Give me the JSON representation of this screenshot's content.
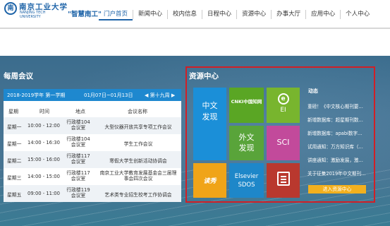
{
  "header": {
    "logo_mark": "南",
    "logo_cn": "南京工业大学",
    "logo_en": "NANJING TECH UNIVERSITY",
    "slogan": "\"智慧南工\"",
    "nav": [
      "门户首页",
      "新闻中心",
      "校内信息",
      "日程中心",
      "资源中心",
      "办事大厅",
      "应用中心",
      "个人中心"
    ]
  },
  "meetings": {
    "title": "每周会议",
    "semester": "2018-2019学年 第一学期",
    "range": "01月07日~01月13日",
    "week": "◀ 第十九周 ▶",
    "columns": [
      "星期",
      "时间",
      "地点",
      "会议名称"
    ],
    "rows": [
      {
        "day": "星期一",
        "time": "10:00 - 12:00",
        "place": "行政楼104会议室",
        "name": "大型仪器开放共享专项工作会议"
      },
      {
        "day": "星期一",
        "time": "14:00 - 16:30",
        "place": "行政楼104会议室",
        "name": "学生工作会议"
      },
      {
        "day": "星期二",
        "time": "15:00 - 16:00",
        "place": "行政楼117会议室",
        "name": "寒假大学生创新活动协调会"
      },
      {
        "day": "星期三",
        "time": "14:00 - 15:00",
        "place": "行政楼117会议室",
        "name": "南京工业大学教育发展基金会三届理事会四次会议"
      },
      {
        "day": "星期五",
        "time": "09:00 - 11:00",
        "place": "行政楼119会议室",
        "name": "艺术类专业招生校考工作协调会"
      }
    ]
  },
  "resources": {
    "title": "资源中心",
    "tiles": {
      "zhongwen_faxian": "中文发现",
      "cnki": "CNKI中国知网",
      "ei": "EI",
      "waiwen_faxian": "外文发现",
      "sci": "SCI",
      "duxiu": "读秀",
      "elsevier": "Elsevier SDOS",
      "book_icon": "book-icon"
    },
    "news_title": "动态",
    "news": [
      "重磅！《中文核心期刊要...",
      "新增数据库：超星期刊数...",
      "新增数据库：apabi数字...",
      "试用通知：万方知识库（...",
      "讲座通知：激励发展，激...",
      "关于征集2019年中文期刊..."
    ],
    "enter_button": "进入资源中心"
  },
  "colors": {
    "brand": "#1d63a8",
    "accent": "#1e88cf",
    "highlight": "#d11f26"
  }
}
